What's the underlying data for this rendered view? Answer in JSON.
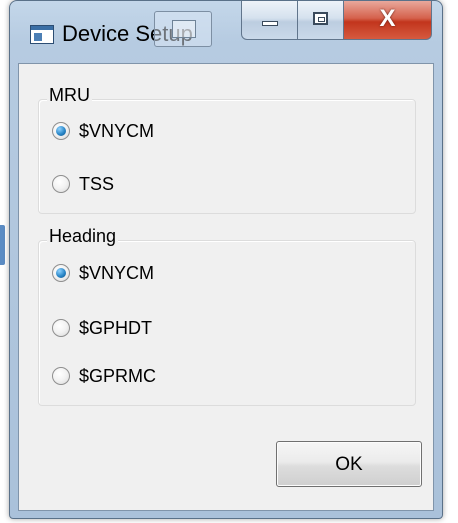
{
  "window": {
    "title": "Device Setup",
    "close_glyph": "X"
  },
  "icons": {
    "app": "application-window-icon",
    "minimize": "minimize-icon",
    "maximize": "maximize-icon",
    "close": "close-icon"
  },
  "mru": {
    "title": "MRU",
    "options": [
      {
        "label": "$VNYCM",
        "checked": true
      },
      {
        "label": "TSS",
        "checked": false
      }
    ]
  },
  "heading": {
    "title": "Heading",
    "options": [
      {
        "label": "$VNYCM",
        "checked": true
      },
      {
        "label": "$GPHDT",
        "checked": false
      },
      {
        "label": "$GPRMC",
        "checked": false
      }
    ]
  },
  "buttons": {
    "ok_label": "OK"
  },
  "colors": {
    "frame": "#b6cbe1",
    "client": "#f0f0f0",
    "close_button": "#c2351d",
    "radio_selected": "#2a87c8"
  }
}
